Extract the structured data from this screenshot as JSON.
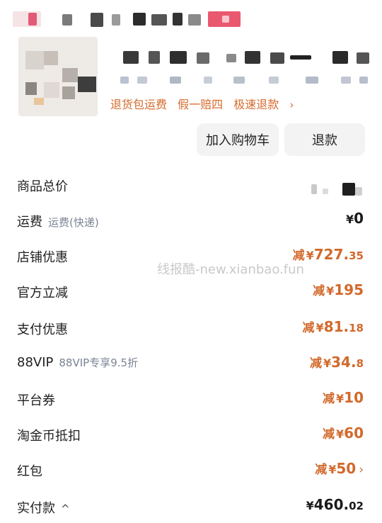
{
  "product": {
    "service_tags": [
      "退货包运费",
      "假一赔四",
      "极速退款"
    ],
    "service_chevron": "›"
  },
  "actions": {
    "add_to_cart": "加入购物车",
    "refund": "退款"
  },
  "price_rows": [
    {
      "label": "商品总价"
    },
    {
      "label": "运费",
      "sub": "运费(快递)",
      "currency": "¥",
      "amount": "0"
    },
    {
      "label": "店铺优惠",
      "prefix": "减",
      "currency": "¥",
      "amount": "727.",
      "decimals": "35"
    },
    {
      "label": "官方立减",
      "prefix": "减",
      "currency": "¥",
      "amount": "195"
    },
    {
      "label": "支付优惠",
      "prefix": "减",
      "currency": "¥",
      "amount": "81.",
      "decimals": "18"
    },
    {
      "label": "88VIP",
      "sub": "88VIP专享9.5折",
      "prefix": "减",
      "currency": "¥",
      "amount": "34.",
      "decimals": "8"
    },
    {
      "label": "平台券",
      "prefix": "减",
      "currency": "¥",
      "amount": "10"
    },
    {
      "label": "淘金币抵扣",
      "prefix": "减",
      "currency": "¥",
      "amount": "60"
    },
    {
      "label": "红包",
      "prefix": "减",
      "currency": "¥",
      "amount": "50",
      "chevron": "›"
    },
    {
      "label": "实付款",
      "caret": "^",
      "currency": "¥",
      "amount": "460.",
      "decimals": "02"
    }
  ],
  "watermark": "线报酷-new.xianbao.fun",
  "colors": {
    "discount": "#d2692b",
    "service": "#d66a2c",
    "subtext": "#7a8394",
    "button_bg": "#f3f3f3"
  }
}
